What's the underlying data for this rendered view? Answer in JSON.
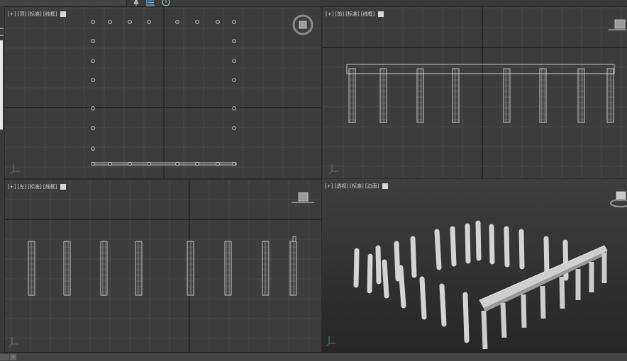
{
  "toolbar": {
    "icons": [
      "pin-icon",
      "list-icon",
      "help-icon"
    ]
  },
  "viewports": [
    {
      "id": "top",
      "label": "[+] [顶] [标准] [线框]",
      "active": false
    },
    {
      "id": "front",
      "label": "[+] [前] [标准] [线框]",
      "active": false
    },
    {
      "id": "left",
      "label": "[+] [左] [标准] [线框]",
      "active": false
    },
    {
      "id": "perspective",
      "label": "[+] [透视] [标准] [边面]",
      "active": true
    }
  ],
  "colors": {
    "viewport_bg": "#3c3c3c",
    "grid": "#4a4a4a",
    "grid_axis": "#1e1e1e",
    "active_border": "#a08c3c",
    "object_wire": "#d8d8d8"
  },
  "bottombar": {
    "scroll_arrow": "›"
  }
}
